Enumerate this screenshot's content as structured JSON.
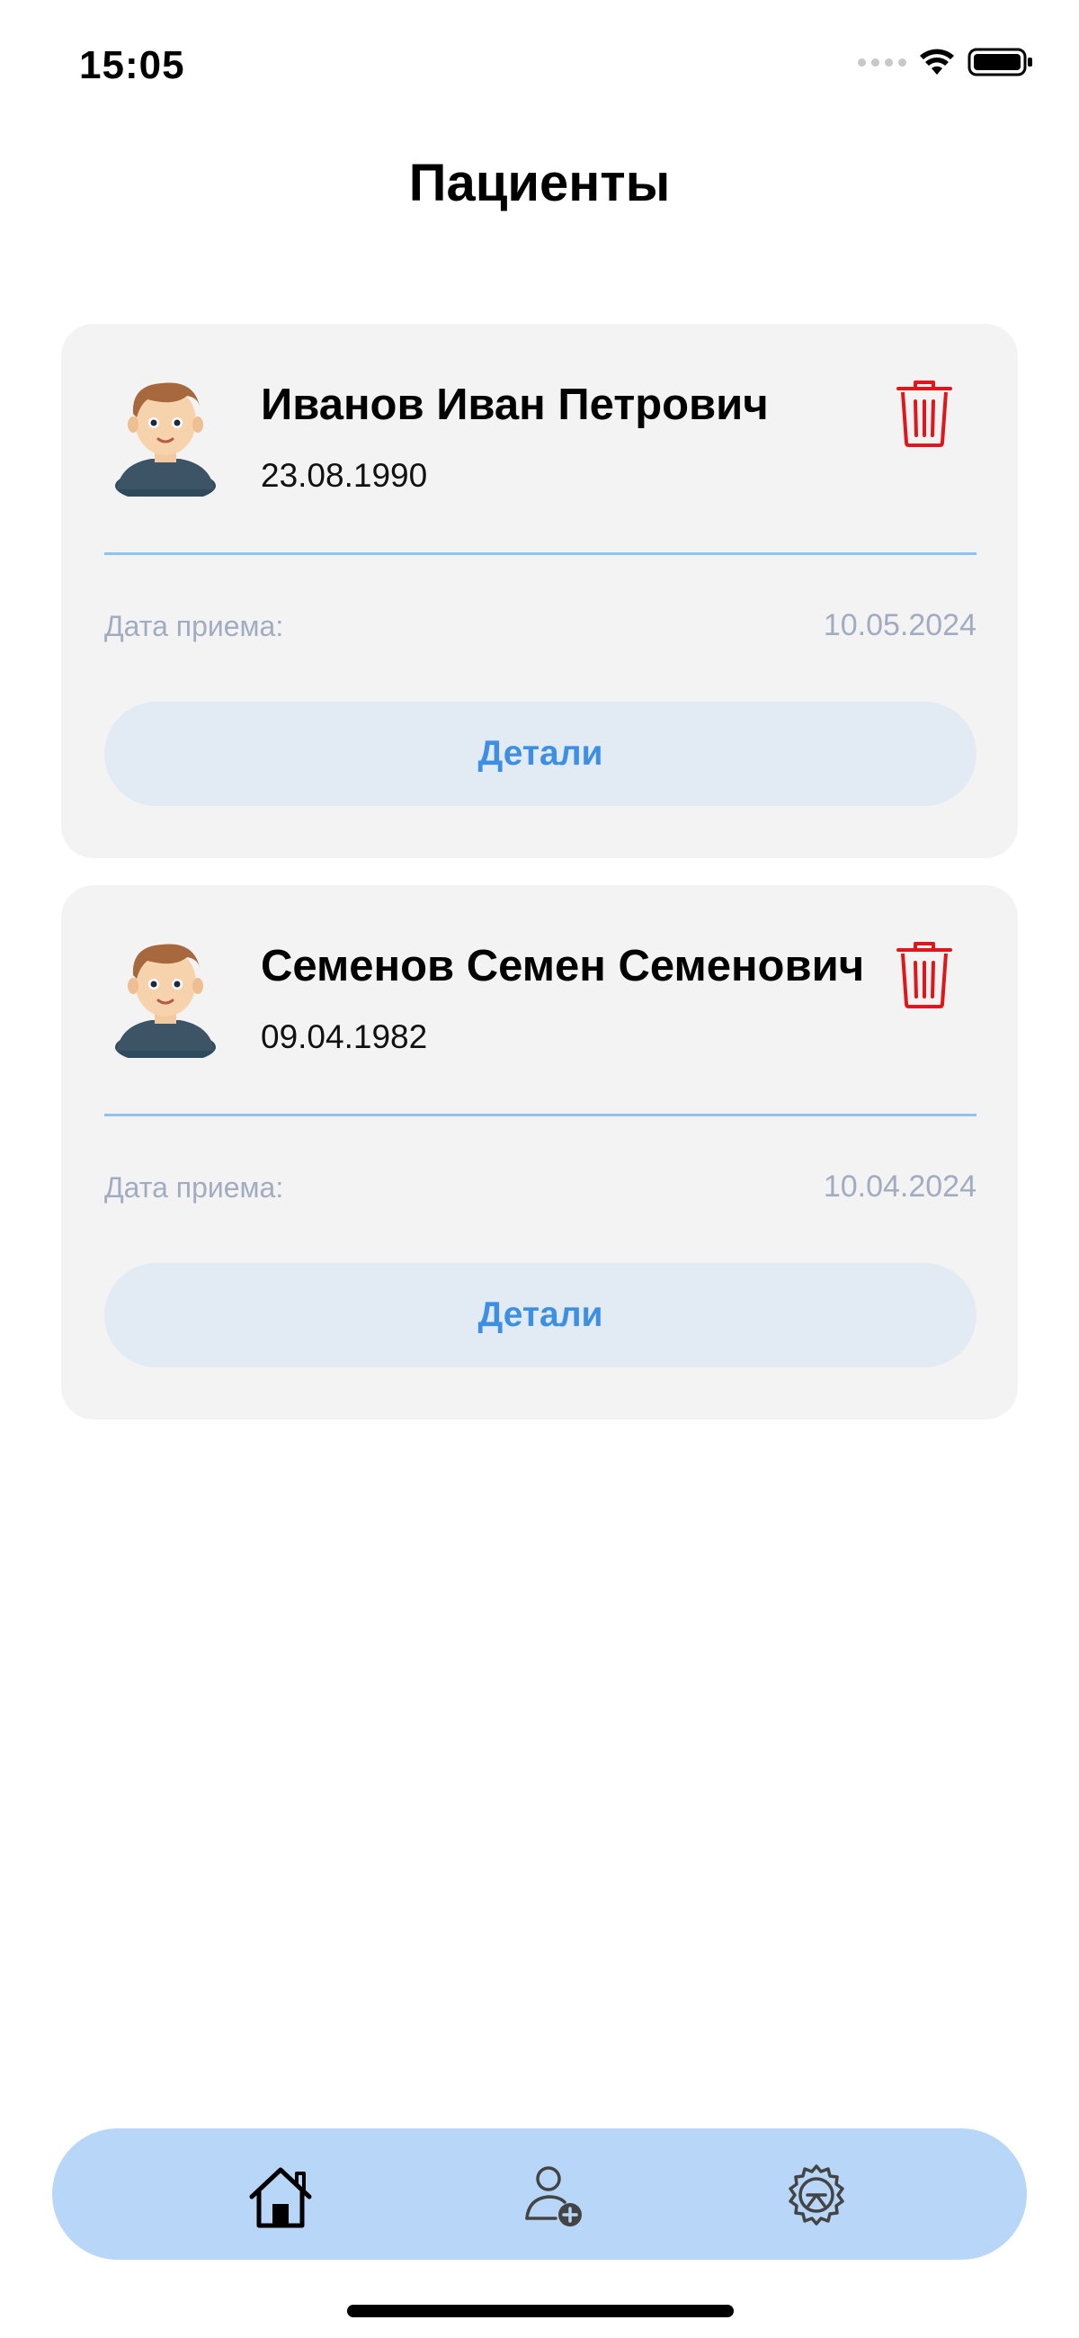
{
  "status_bar": {
    "time": "15:05",
    "icons": [
      "signal-dots-icon",
      "wifi-icon",
      "battery-icon"
    ]
  },
  "header": {
    "title": "Пациенты"
  },
  "patients": [
    {
      "name": "Иванов Иван Петрович",
      "birth_date": "23.08.1990",
      "visit_label": "Дата приема:",
      "visit_date": "10.05.2024",
      "details_label": "Детали"
    },
    {
      "name": "Семенов Семен Семенович",
      "birth_date": "09.04.1982",
      "visit_label": "Дата приема:",
      "visit_date": "10.04.2024",
      "details_label": "Детали"
    }
  ],
  "tabbar": {
    "items": [
      "home-icon",
      "add-user-icon",
      "settings-icon"
    ],
    "active": "home-icon"
  },
  "colors": {
    "card_background": "#f3f3f4",
    "divider": "#8dc3ee",
    "details_button_bg": "#e2ebf4",
    "details_button_text": "#3d8fe3",
    "delete_icon": "#e0161b",
    "muted_text": "#a2acc0",
    "tabbar_background": "#b8d7f8"
  }
}
